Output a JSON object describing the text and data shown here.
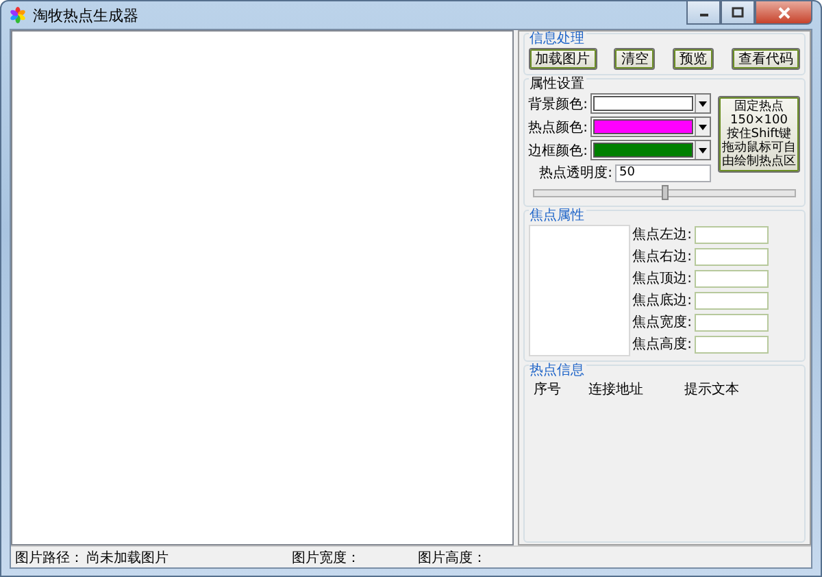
{
  "window": {
    "title": "淘牧热点生成器"
  },
  "info": {
    "title": "信息处理",
    "buttons": [
      "加载图片",
      "清空",
      "预览",
      "查看代码"
    ]
  },
  "properties": {
    "title": "属性设置",
    "colors": [
      {
        "label": "背景颜色:",
        "color": "#ffffff"
      },
      {
        "label": "热点颜色:",
        "color": "#ff00ff"
      },
      {
        "label": "边框颜色:",
        "color": "#008000"
      }
    ],
    "opacity": {
      "label": "热点透明度:",
      "value": "50"
    },
    "slider": {
      "level": 0.5
    },
    "fixed_button": [
      "固定热点",
      "150×100",
      "按住Shift键",
      "拖动鼠标可自",
      "由绘制热点区"
    ]
  },
  "focus": {
    "title": "焦点属性",
    "fields": [
      "焦点左边:",
      "焦点右边:",
      "焦点顶边:",
      "焦点底边:",
      "焦点宽度:",
      "焦点高度:"
    ]
  },
  "hotspots": {
    "title": "热点信息",
    "columns": [
      "序号",
      "连接地址",
      "提示文本"
    ]
  },
  "status_bar": [
    "图片路径：",
    "尚未加载图片",
    "图片宽度：",
    "图片高度："
  ]
}
